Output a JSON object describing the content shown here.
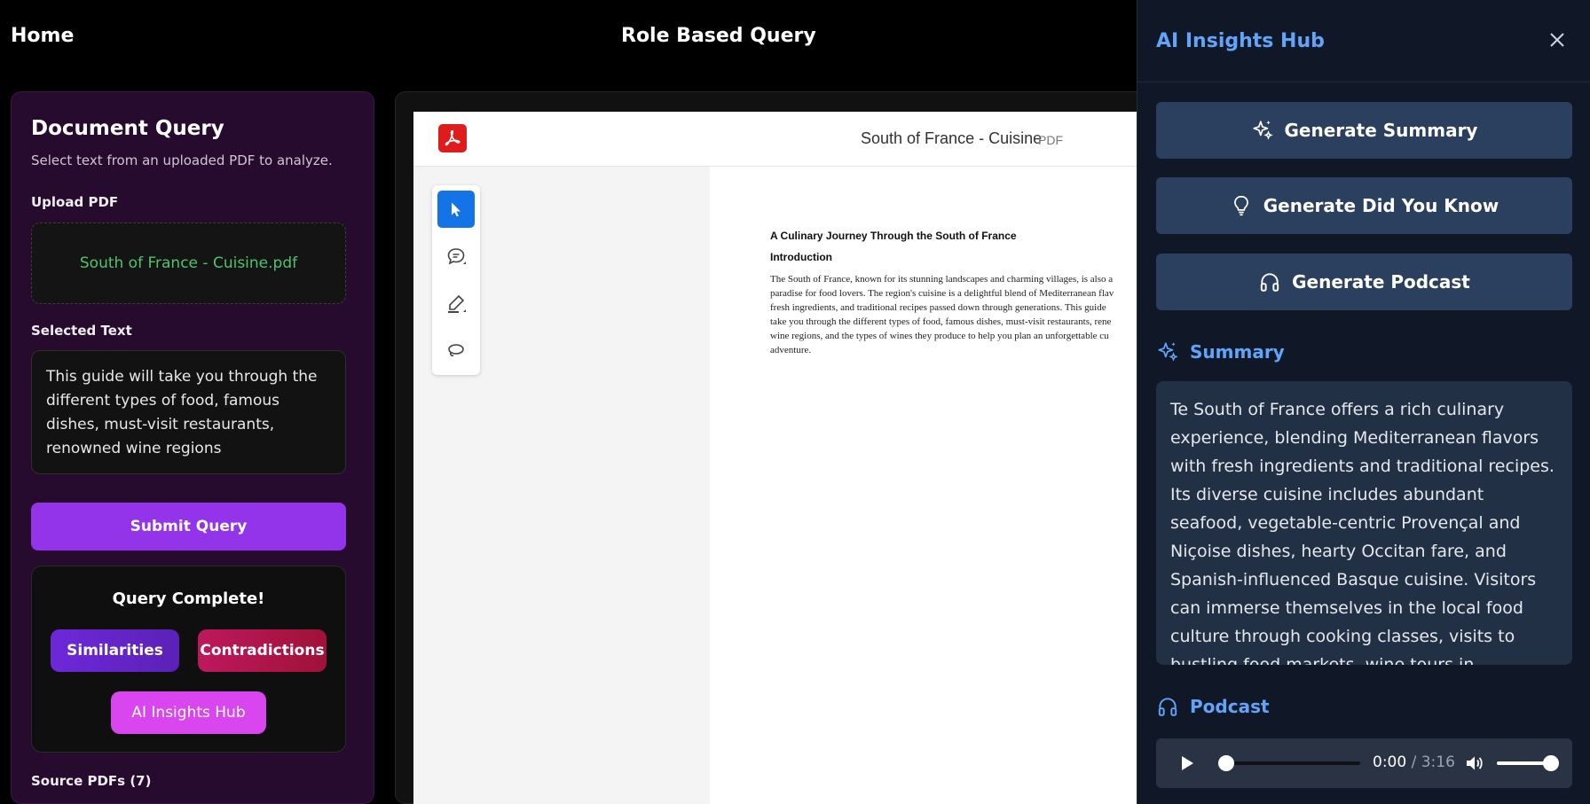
{
  "header": {
    "home_label": "Home",
    "page_title": "Role Based Query"
  },
  "query_panel": {
    "title": "Document Query",
    "subtitle": "Select text from an uploaded PDF to analyze.",
    "upload_label": "Upload PDF",
    "uploaded_file": "South of France - Cuisine.pdf",
    "selected_label": "Selected Text",
    "selected_text": "This guide will take you through the different types of food, famous dishes, must-visit restaurants, renowned wine regions",
    "submit_label": "Submit Query",
    "complete_title": "Query Complete!",
    "similarities_label": "Similarities",
    "contradictions_label": "Contradictions",
    "hub_label": "AI Insights Hub",
    "source_label": "Source PDFs (7)"
  },
  "viewer": {
    "doc_name": "South of France - Cuisine",
    "doc_type": "PDF",
    "doc_heading": "A Culinary Journey Through the South of France",
    "doc_subheading": "Introduction",
    "doc_lines": [
      "The South of France, known for its stunning landscapes and charming villages, is also a",
      "paradise for food lovers. The region's cuisine is a delightful blend of Mediterranean flav",
      "fresh ingredients, and traditional recipes passed down through generations. This guide",
      "take you through the different types of food, famous dishes, must-visit restaurants, rene",
      "wine regions, and the types of wines they produce to help you plan an unforgettable cu",
      "adventure."
    ]
  },
  "insights": {
    "title": "AI Insights Hub",
    "btn_summary": "Generate Summary",
    "btn_did_you_know": "Generate Did You Know",
    "btn_podcast": "Generate Podcast",
    "summary_label": "Summary",
    "summary_text": "Te South of France offers a rich culinary experience, blending Mediterranean flavors with fresh ingredients and traditional recipes. Its diverse cuisine includes abundant seafood, vegetable-centric Provençal and Niçoise dishes, hearty Occitan fare, and Spanish-influenced Basque cuisine. Visitors can immerse themselves in the local food culture through cooking classes, visits to bustling food markets, wine tours in renowned",
    "podcast_label": "Podcast",
    "audio_current": "0:00",
    "audio_duration": " / 3:16",
    "audio_progress": 0
  },
  "colors": {
    "accent_purple": "#9333ea",
    "accent_blue": "#60a5fa",
    "panel_bg": "#260b2f",
    "pdf_red": "#e01b1b"
  },
  "icons": [
    "pdf-logo-icon",
    "select-tool-icon",
    "comment-tool-icon",
    "highlight-tool-icon",
    "lasso-tool-icon",
    "close-icon",
    "sparkles-icon",
    "lightbulb-icon",
    "headphones-icon",
    "play-icon",
    "volume-icon"
  ]
}
